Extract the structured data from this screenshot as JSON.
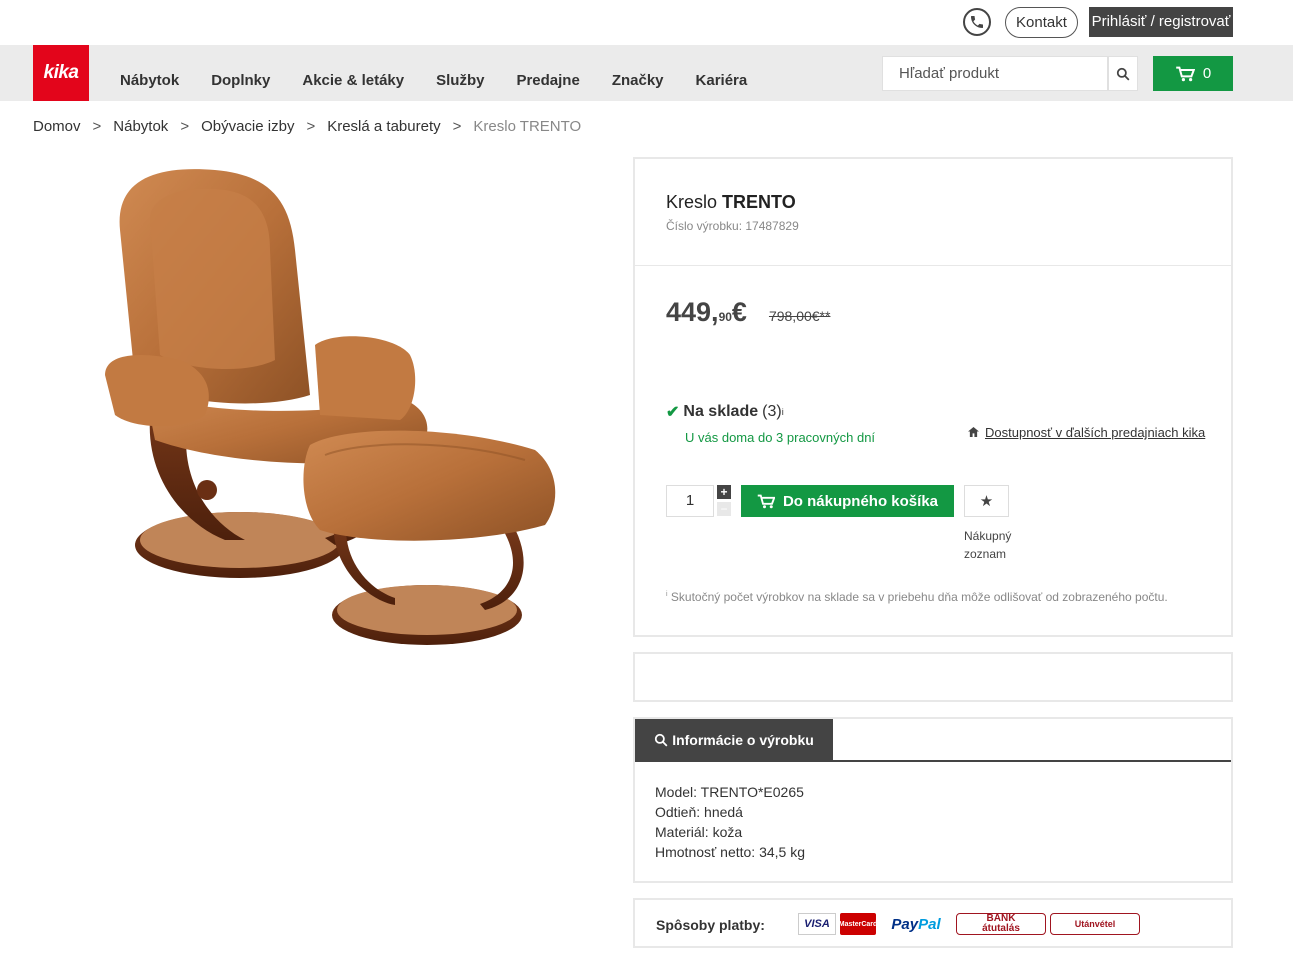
{
  "header": {
    "phone_icon": "phone-icon",
    "contact_label": "Kontakt",
    "login_label": "Prihlásiť / registrovať"
  },
  "nav": {
    "logo_text": "kika",
    "items": [
      "Nábytok",
      "Doplnky",
      "Akcie & letáky",
      "Služby",
      "Predajne",
      "Značky",
      "Kariéra"
    ],
    "search_placeholder": "Hľadať produkt",
    "cart_count": "0"
  },
  "breadcrumb": {
    "items": [
      "Domov",
      "Nábytok",
      "Obývacie izby",
      "Kreslá a taburety"
    ],
    "current": "Kreslo TRENTO",
    "separator": ">"
  },
  "product": {
    "title_prefix": "Kreslo ",
    "title_name": "TRENTO",
    "number_text": "Číslo výrobku: 17487829",
    "price_main": "449,",
    "price_cents": "90",
    "price_currency": "€",
    "price_old": "798,00€**",
    "stock_label": "Na sklade",
    "stock_count": "(3)",
    "stock_note_mark": "i",
    "delivery_text": "U vás doma do 3 pracovných dní",
    "availability_link": "Dostupnosť v ďalších predajniach kika",
    "quantity": "1",
    "add_to_cart_label": "Do nákupného košíka",
    "wishlist_label_1": "Nákupný",
    "wishlist_label_2": "zoznam",
    "note_mark": "i",
    "note_text": "Skutočný počet výrobkov na sklade sa v priebehu dňa môže odlišovať od zobrazeného počtu."
  },
  "info": {
    "tab_label": "Informácie o výrobku",
    "lines": [
      "Model: TRENTO*E0265",
      "Odtieň: hnedá",
      "Materiál: koža",
      "Hmotnosť netto: 34,5 kg"
    ]
  },
  "payment": {
    "label": "Spôsoby platby:",
    "visa": "VISA",
    "mastercard": "MasterCard",
    "paypal_1": "Pay",
    "paypal_2": "Pal",
    "bank_1": "BANK",
    "bank_2": "átutalás",
    "utanvetel": "Utánvétel"
  },
  "colors": {
    "brand_red": "#e3051b",
    "accent_green": "#139843",
    "dark": "#444444"
  }
}
